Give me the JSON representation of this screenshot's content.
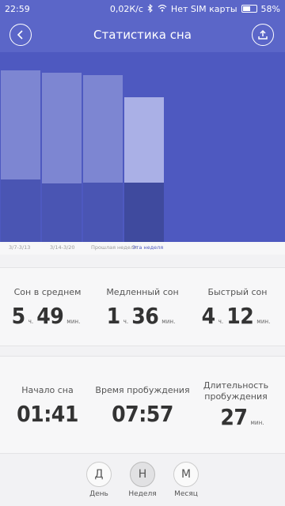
{
  "status_bar": {
    "time": "22:59",
    "speed": "0,02К/с",
    "sim": "Нет SIM карты",
    "battery": "58%",
    "battery_level": 0.58
  },
  "header": {
    "title": "Статистика сна",
    "back_icon": "chevron-left-icon",
    "share_icon": "upload-icon"
  },
  "chart_data": {
    "type": "bar",
    "categories": [
      "3/7-3/13",
      "3/14-3/20",
      "Прошлая неделя",
      "Эта неделя"
    ],
    "series": [
      {
        "values": [
          3.45,
          3.25,
          3.3,
          3.3
        ]
      },
      {
        "values": [
          6.05,
          6.1,
          5.95,
          4.7
        ]
      }
    ],
    "stacked": true,
    "selected_category": "Эта неделя",
    "ylim": [
      0,
      10.5
    ],
    "colors": {
      "background": "#4e59c0",
      "bottom": "#4a55b3",
      "top": "#7d86d2",
      "bottom_selected": "#3f4a9e",
      "top_selected": "#aab0e6"
    }
  },
  "stats_row1": [
    {
      "label": "Сон в среднем",
      "h": "5",
      "h_unit": "ч.",
      "m": "49",
      "m_unit": "мин."
    },
    {
      "label": "Медленный сон",
      "h": "1",
      "h_unit": "ч.",
      "m": "36",
      "m_unit": "мин."
    },
    {
      "label": "Быстрый сон",
      "h": "4",
      "h_unit": "ч.",
      "m": "12",
      "m_unit": "мин."
    }
  ],
  "stats_row2": {
    "sleep_start": {
      "label": "Начало сна",
      "value": "01:41"
    },
    "wake_time": {
      "label": "Время пробуждения",
      "value": "07:57"
    },
    "wake_duration": {
      "label1": "Длительность",
      "label2": "пробуждения",
      "value": "27",
      "unit": "мин."
    }
  },
  "bottom_nav": [
    {
      "letter": "Д",
      "label": "День"
    },
    {
      "letter": "Н",
      "label": "Неделя"
    },
    {
      "letter": "М",
      "label": "Месяц"
    }
  ]
}
